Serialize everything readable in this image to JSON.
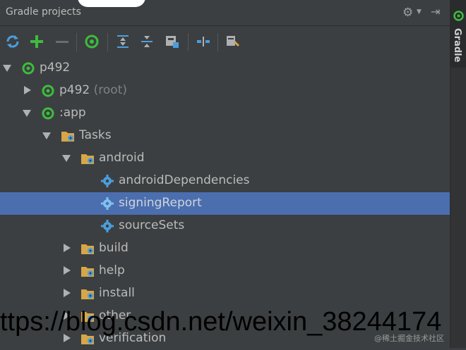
{
  "window": {
    "title": "Gradle projects"
  },
  "side_panel": {
    "label": "Gradle"
  },
  "toolbar": {
    "buttons": [
      "refresh-icon",
      "add-icon",
      "remove-icon",
      "gradle-icon",
      "expand-all-icon",
      "collapse-all-icon",
      "attach-icon",
      "toggle-offline-icon",
      "settings-wrench-icon"
    ]
  },
  "tree": {
    "project": "p492",
    "root_module": "p492",
    "root_suffix": "(root)",
    "app_module": ":app",
    "tasks": "Tasks",
    "android": "android",
    "android_dependencies": "androidDependencies",
    "signing_report": "signingReport",
    "source_sets": "sourceSets",
    "build": "build",
    "help": "help",
    "install": "install",
    "other": "other",
    "verification": "verification"
  },
  "overlay": {
    "url": "ttps://blog.csdn.net/weixin_38244174",
    "watermark": "@稀土掘金技术社区"
  },
  "colors": {
    "background": "#3c3f41",
    "selection": "#4b6eaf",
    "gradle_green": "#3dbd3d",
    "folder_orange": "#d6a648",
    "task_blue": "#4a9fde"
  }
}
